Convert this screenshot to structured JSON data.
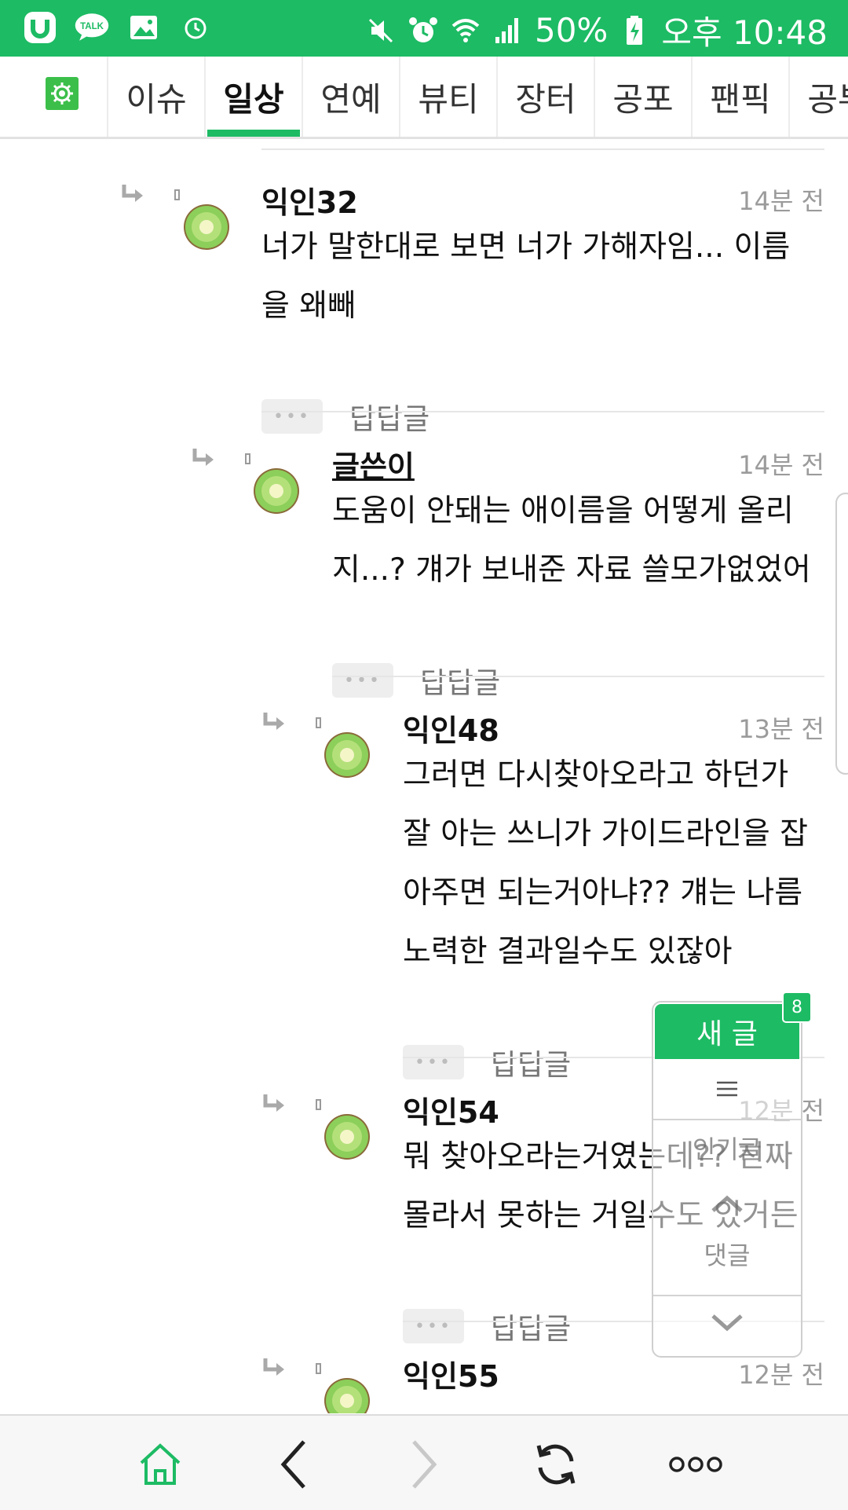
{
  "status_bar": {
    "battery": "50%",
    "time": "오후 10:48",
    "talk_label": "TALK"
  },
  "tabs": {
    "items": [
      "이슈",
      "일상",
      "연예",
      "뷰티",
      "장터",
      "공포",
      "팬픽",
      "공부"
    ],
    "active": "일상"
  },
  "comments": [
    {
      "author": "익인32",
      "time": "14분 전",
      "text": [
        "너가 말한대로 보면 너가 가해자임... 이름",
        "을 왜빼"
      ],
      "reply_label": "답답글"
    },
    {
      "author": "글쓴이",
      "time": "14분 전",
      "text": [
        "도움이 안돼는 애이름을 어떻게 올리",
        "지...? 걔가 보내준 자료 쓸모가없었어"
      ],
      "reply_label": "답답글"
    },
    {
      "author": "익인48",
      "time": "13분 전",
      "text": [
        "그러면 다시찾아오라고 하던가",
        "잘 아는 쓰니가 가이드라인을 잡",
        "아주면 되는거아냐?? 걔는 나름",
        "노력한 결과일수도 있잖아"
      ],
      "reply_label": "답답글"
    },
    {
      "author": "익인54",
      "time": "12분 전",
      "text": [
        "뭐 찾아오라는거였는데?? 진짜",
        "몰라서 못하는 거일수도 있거든"
      ],
      "reply_label": "답답글"
    },
    {
      "author": "익인55",
      "time": "12분 전",
      "text": [],
      "reply_label": ""
    }
  ],
  "float_panel": {
    "new_post": "새 글",
    "badge": "8",
    "menu_icon": "menu-icon",
    "popular": "인기글",
    "comments": "댓글"
  },
  "bottom_bar": {
    "icons": [
      "home-icon",
      "back-icon",
      "forward-icon",
      "refresh-icon",
      "more-icon"
    ]
  },
  "colors": {
    "brand": "#1dbb64",
    "muted_text": "#9b9b9b"
  }
}
